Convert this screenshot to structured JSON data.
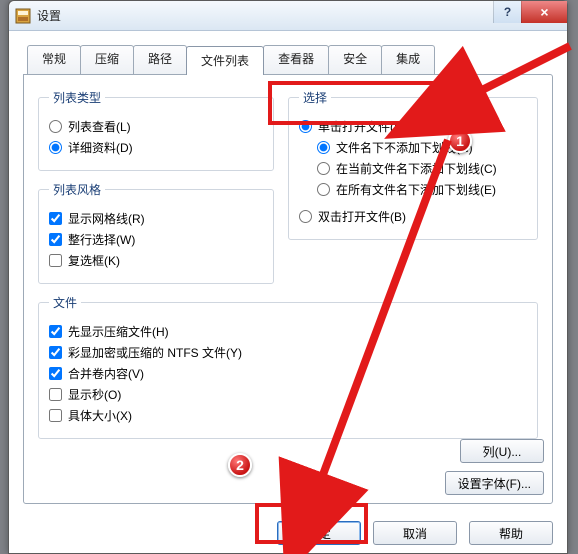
{
  "window": {
    "title": "设置",
    "help": "?",
    "close": "×"
  },
  "tabs": {
    "general": "常规",
    "compress": "压缩",
    "path": "路径",
    "filelist": "文件列表",
    "viewer": "查看器",
    "security": "安全",
    "integration": "集成"
  },
  "list_type": {
    "legend": "列表类型",
    "list_view": "列表查看(L)",
    "details": "详细资料(D)"
  },
  "list_style": {
    "legend": "列表风格",
    "gridlines": "显示网格线(R)",
    "full_row": "整行选择(W)",
    "checkbox": "复选框(K)"
  },
  "selection": {
    "legend": "选择",
    "single_click": "单击打开文件(S)",
    "no_underline": "文件名下不添加下划线(N)",
    "underline_current": "在当前文件名下添加下划线(C)",
    "underline_all": "在所有文件名下添加下划线(E)",
    "double_click": "双击打开文件(B)"
  },
  "files": {
    "legend": "文件",
    "compressed_first": "先显示压缩文件(H)",
    "ntfs_color": "彩显加密或压缩的 NTFS 文件(Y)",
    "merge_volumes": "合并卷内容(V)",
    "show_seconds": "显示秒(O)",
    "exact_size": "具体大小(X)"
  },
  "buttons": {
    "columns": "列(U)...",
    "font": "设置字体(F)...",
    "ok": "确定",
    "cancel": "取消",
    "help": "帮助"
  },
  "annotations": {
    "badge1": "1",
    "badge2": "2"
  }
}
